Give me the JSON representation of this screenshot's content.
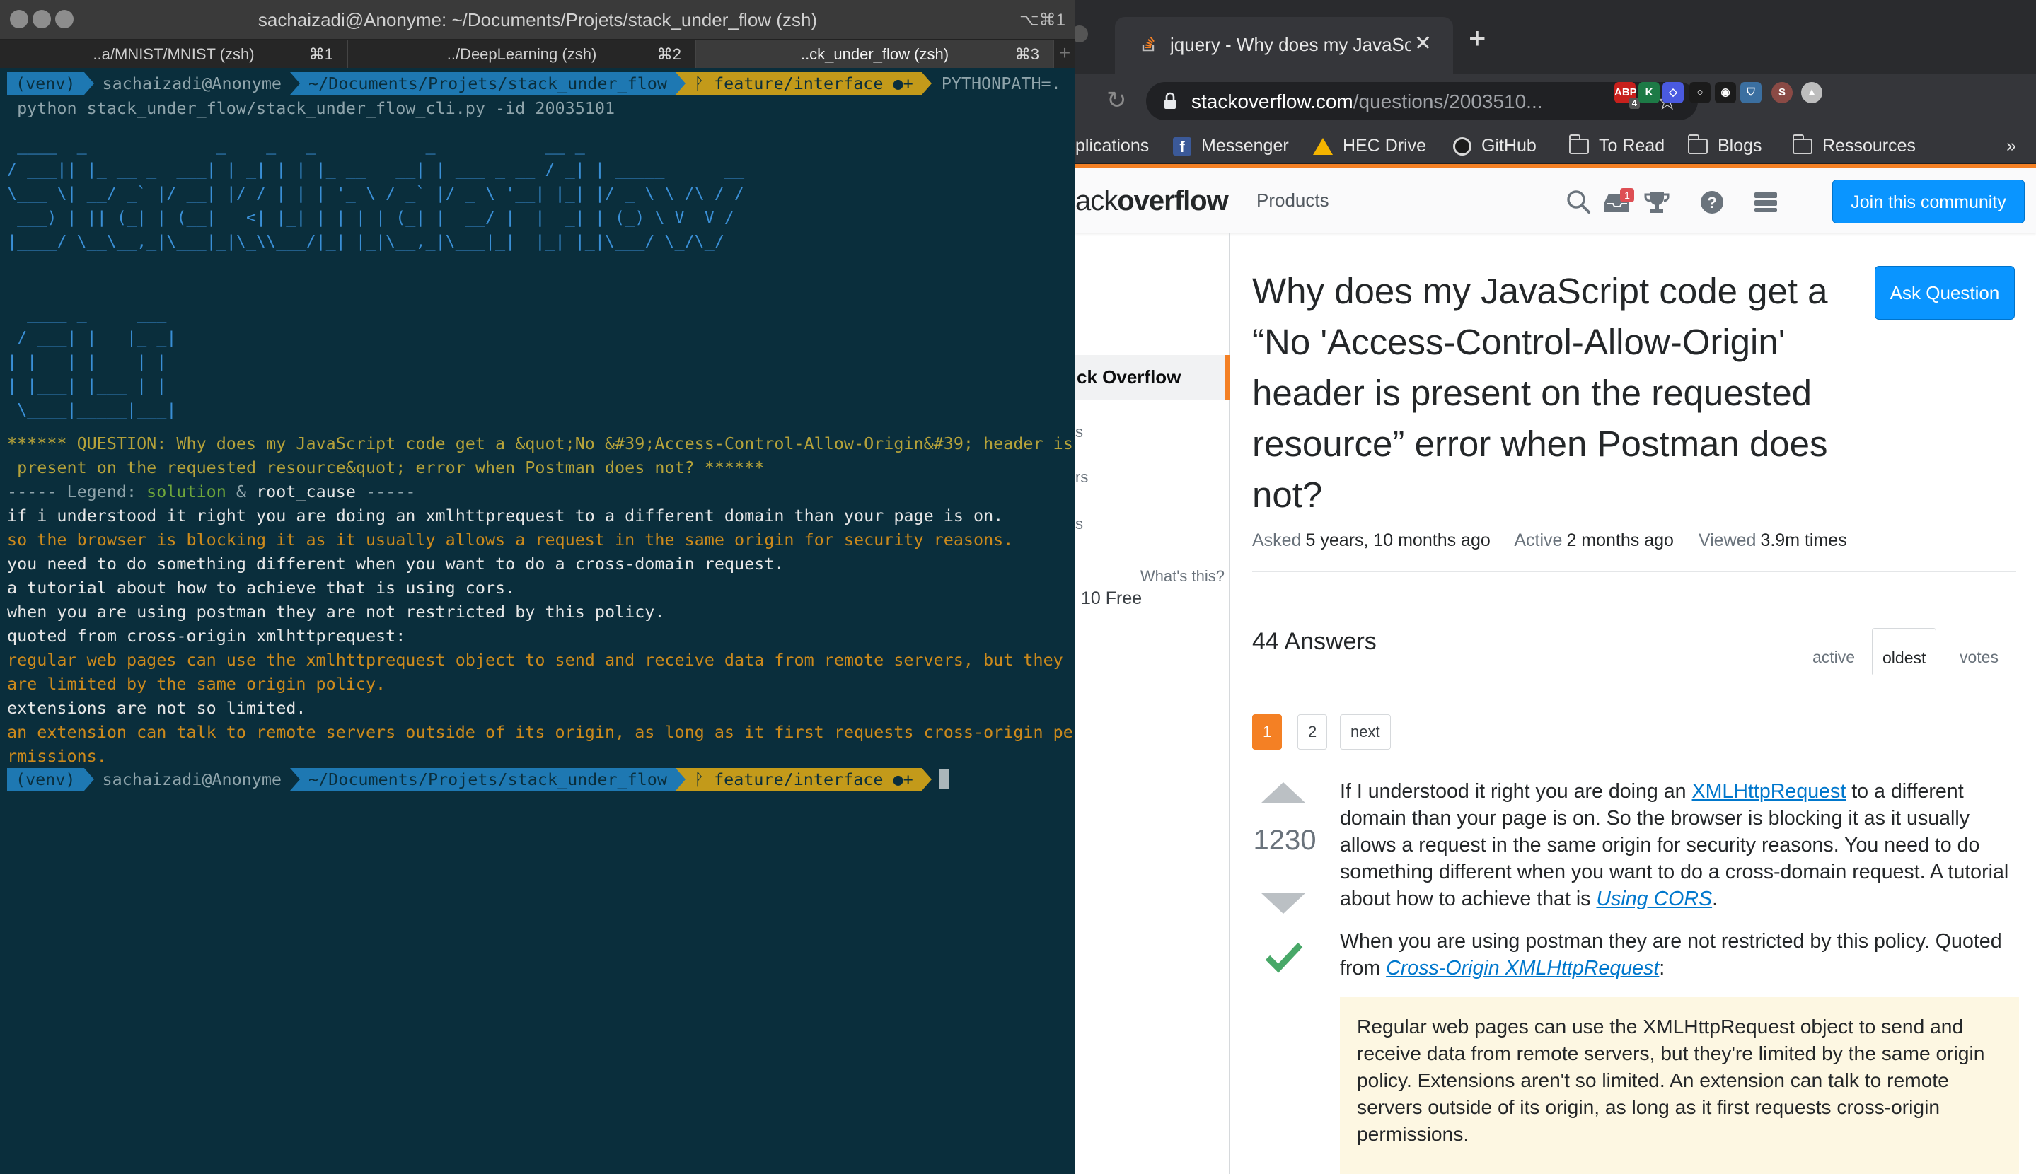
{
  "terminal": {
    "title": "sachaizadi@Anonyme: ~/Documents/Projets/stack_under_flow (zsh)",
    "shortcut": "⌥⌘1",
    "tabs": [
      {
        "label": "..a/MNIST/MNIST (zsh)",
        "key": "⌘1"
      },
      {
        "label": "../DeepLearning (zsh)",
        "key": "⌘2"
      },
      {
        "label": "..ck_under_flow (zsh)",
        "key": "⌘3"
      }
    ],
    "prompt": {
      "venv": "(venv)",
      "user": "sachaizadi@Anonyme",
      "path": "~/Documents/Projets/stack_under_flow",
      "git": "ᚹ feature/interface ●+",
      "command_tail": "PYTHONPATH=."
    },
    "command_line2": " python stack_under_flow/stack_under_flow_cli.py -id 20035101",
    "ascii_banner": [
      " ____  _             _    _   _           _           __ _",
      "/ ___|| |_ __ _  ___| | _| | | |_ __   __| | ___ _ __ / _| | _____      __",
      "\\___ \\| __/ _` |/ __| |/ / | | | '_ \\ / _` |/ _ \\ '__| |_| |/ _ \\ \\ /\\ / /",
      " ___) | || (_| | (__|   <| |_| | | | | (_| |  __/ |  |  _| | (_) \\ V  V /",
      "|____/ \\__\\__,_|\\___|_|\\_\\\\___/|_| |_|\\__,_|\\___|_|  |_| |_|\\___/ \\_/\\_/",
      "",
      "",
      "  ____ _     ___",
      " / ___| |   |_ _|",
      "| |   | |    | |",
      "| |___| |___ | |",
      " \\____|_____|___|"
    ],
    "question_line1": "****** QUESTION: Why does my JavaScript code get a &quot;No &#39;Access-Control-Allow-Origin&#39; header is",
    "question_line2": " present on the requested resource&quot; error when Postman does not? ******",
    "legend_prefix": "----- Legend: ",
    "legend_solution": "solution",
    "legend_amp": " & ",
    "legend_root": "root_cause",
    "legend_suffix": " -----",
    "output_lines": [
      {
        "text": "if i understood it right you are doing an xmlhttprequest to a different domain than your page is on.",
        "kind": "white"
      },
      {
        "text": "so the browser is blocking it as it usually allows a request in the same origin for security reasons.",
        "kind": "orange"
      },
      {
        "text": "you need to do something different when you want to do a cross-domain request.",
        "kind": "white"
      },
      {
        "text": "a tutorial about how to achieve that is using cors.",
        "kind": "white"
      },
      {
        "text": "when you are using postman they are not restricted by this policy.",
        "kind": "white"
      },
      {
        "text": "quoted from cross-origin xmlhttprequest:",
        "kind": "white"
      },
      {
        "text": "regular web pages can use the xmlhttprequest object to send and receive data from remote servers, but they",
        "kind": "orange"
      },
      {
        "text": "are limited by the same origin policy.",
        "kind": "orange"
      },
      {
        "text": "extensions are not so limited.",
        "kind": "white"
      },
      {
        "text": "an extension can talk to remote servers outside of its origin, as long as it first requests cross-origin pe",
        "kind": "orange"
      },
      {
        "text": "rmissions.",
        "kind": "orange"
      }
    ]
  },
  "browser": {
    "tab_title": "jquery - Why does my JavaScri",
    "url_host": "stackoverflow.com",
    "url_rest": "/questions/2003510...",
    "extensions": [
      {
        "label": "ABP",
        "badge": "4",
        "color": "#c7201c"
      },
      {
        "label": "K",
        "color": "#1d7a46"
      },
      {
        "label": "◇",
        "color": "#4a5ae0"
      },
      {
        "label": "○",
        "color": "#1b1b1b"
      },
      {
        "label": "◉",
        "color": "#1b1b1b"
      },
      {
        "label": "⛉",
        "color": "#3b6fa0"
      },
      {
        "label": "S",
        "color": "#8a4a45"
      },
      {
        "label": "▲",
        "color": "#bdbdbd"
      }
    ],
    "bookmarks": [
      "plications",
      "Messenger",
      "HEC Drive",
      "GitHub",
      "To Read",
      "Blogs",
      "Ressources"
    ],
    "bookmarks_more": "»"
  },
  "so": {
    "logo_light": "ack",
    "logo_bold": "overflow",
    "products": "Products",
    "inbox_badge": "1",
    "join_label": "Join this community",
    "sidebar_active": "ck Overflow",
    "sidebar_fragments": [
      "s",
      "rs",
      "s"
    ],
    "whats_this": "What's this?",
    "free_teams": "10 Free",
    "question_title": "Why does my JavaScript code get a “No 'Access-Control-Allow-Origin' header is present on the requested resource” error when Postman does not?",
    "ask_label": "Ask Question",
    "asked_label": "Asked",
    "asked_value": "5 years, 10 months ago",
    "active_label": "Active",
    "active_value": "2 months ago",
    "viewed_label": "Viewed",
    "viewed_value": "3.9m times",
    "answers_count": "44 Answers",
    "sort_tabs": [
      "active",
      "oldest",
      "votes"
    ],
    "pages": [
      "1",
      "2",
      "next"
    ],
    "vote_count": "1230",
    "answer_p1_a": "If I understood it right you are doing an ",
    "answer_p1_link1": "XMLHttpRequest",
    "answer_p1_b": " to a different domain than your page is on. So the browser is blocking it as it usually allows a request in the same origin for security reasons. You need to do something different when you want to do a cross-domain request. A tutorial about how to achieve that is ",
    "answer_p1_link2": "Using CORS",
    "answer_p1_c": ".",
    "answer_p2_a": "When you are using postman they are not restricted by this policy. Quoted from ",
    "answer_p2_link": "Cross-Origin XMLHttpRequest",
    "answer_p2_b": ":",
    "quote": "Regular web pages can use the XMLHttpRequest object to send and receive data from remote servers, but they're limited by the same origin policy. Extensions aren't so limited. An extension can talk to remote servers outside of its origin, as long as it first requests cross-origin permissions."
  }
}
